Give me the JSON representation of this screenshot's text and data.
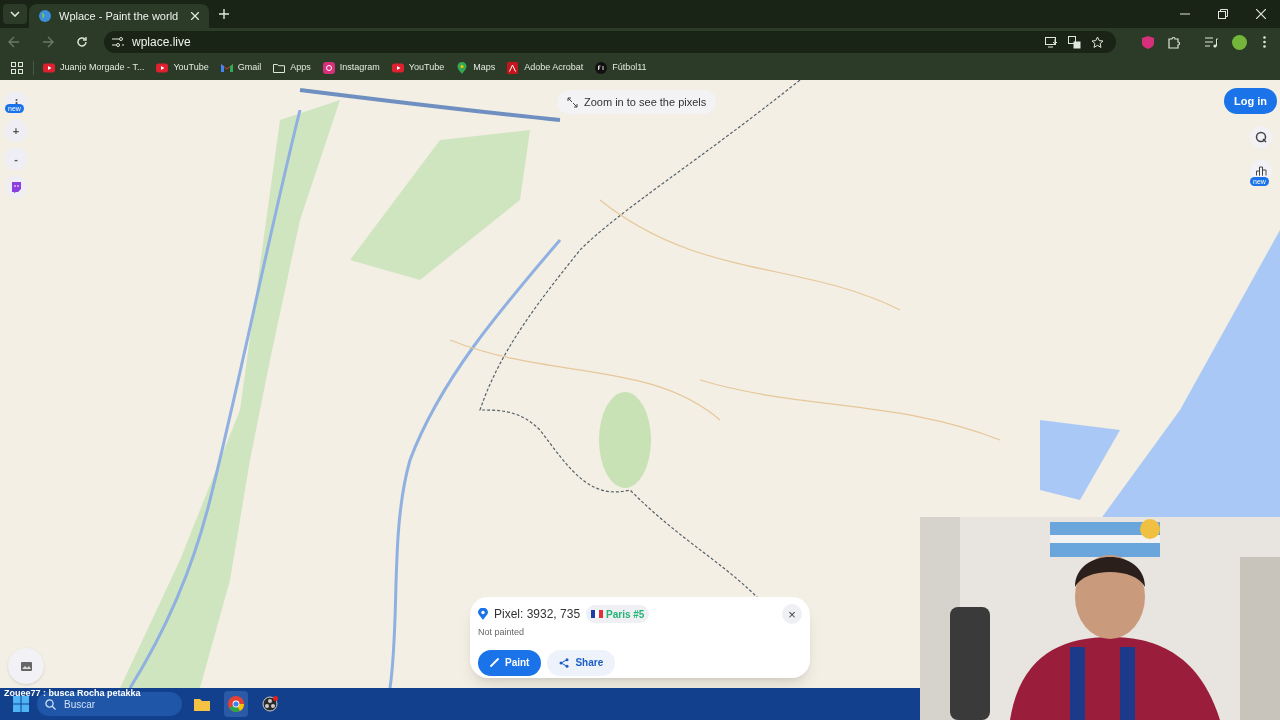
{
  "browser": {
    "tabs": [
      {
        "title": "Wplace - Paint the world",
        "selected": true
      }
    ],
    "url": "wplace.live",
    "bookmarks": [
      {
        "label": "Juanjo Morgade - T...",
        "kind": "youtube"
      },
      {
        "label": "YouTube",
        "kind": "youtube"
      },
      {
        "label": "Gmail",
        "kind": "gmail"
      },
      {
        "label": "Apps",
        "kind": "folder"
      },
      {
        "label": "Instagram",
        "kind": "instagram"
      },
      {
        "label": "YouTube",
        "kind": "youtube"
      },
      {
        "label": "Maps",
        "kind": "maps"
      },
      {
        "label": "Adobe Acrobat",
        "kind": "acrobat"
      },
      {
        "label": "Fútbol11",
        "kind": "futbol"
      }
    ]
  },
  "map": {
    "hint": "Zoom in to see the pixels",
    "login": "Log in",
    "info_badge": "new",
    "zoom_in": "+",
    "zoom_out": "-",
    "stats_badge": "new"
  },
  "pixel_popup": {
    "title": "Pixel: 3932, 735",
    "region": "Paris #5",
    "status": "Not painted",
    "close": "×",
    "actions": [
      {
        "label": "Paint",
        "kind": "primary"
      },
      {
        "label": "Share",
        "kind": "secondary"
      }
    ]
  },
  "chat_overlay": "Zouee77 : busca Rocha petakka",
  "taskbar": {
    "search_placeholder": "Buscar"
  }
}
